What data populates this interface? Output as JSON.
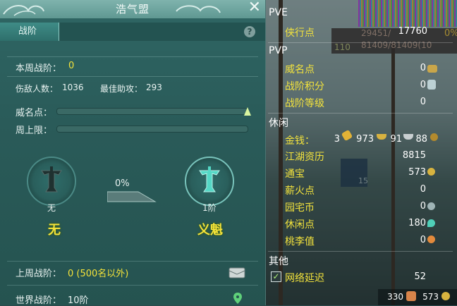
{
  "window": {
    "title": "浩气盟",
    "tab": "战阶"
  },
  "left": {
    "week_rank_label": "本周战阶：",
    "week_rank_value": "0",
    "kills_label": "伤敌人数：",
    "kills_value": "1036",
    "assist_label": "最佳助攻：",
    "assist_value": "293",
    "prestige_label": "威名点：",
    "weekly_cap_label": "周上限：",
    "current_rank_name": "无",
    "current_rank_title": "无",
    "progress_percent": "0%",
    "next_rank_name": "1阶",
    "next_rank_title": "义魁",
    "last_week_label": "上周战阶：",
    "last_week_value": "0 (500名以外)",
    "world_rank_label": "世界战阶：",
    "world_rank_value": "10阶"
  },
  "right": {
    "pve": {
      "header": "PVE",
      "items": [
        {
          "label": "侠行点",
          "value": "17760"
        }
      ]
    },
    "pvp": {
      "header": "PVP",
      "items": [
        {
          "label": "威名点",
          "value": "0"
        },
        {
          "label": "战阶积分",
          "value": "0"
        },
        {
          "label": "战阶等级",
          "value": "0"
        }
      ]
    },
    "leisure": {
      "header": "休闲",
      "money_label": "金钱：",
      "money_brick": "3",
      "money_gold": "973",
      "money_silver": "91",
      "money_copper": "88",
      "items": [
        {
          "label": "江湖资历",
          "value": "8815"
        },
        {
          "label": "通宝",
          "value": "573"
        },
        {
          "label": "薪火点",
          "value": "0"
        },
        {
          "label": "园宅币",
          "value": "0"
        },
        {
          "label": "休闲点",
          "value": "180"
        },
        {
          "label": "桃李值",
          "value": "0"
        }
      ]
    },
    "other": {
      "header": "其他",
      "latency_label": "网络延迟",
      "latency_value": "52"
    },
    "footer": {
      "left_value": "330",
      "right_value": "573"
    }
  },
  "background": {
    "stats1": "29451/",
    "stats2": "81409/81409(10",
    "level": "110",
    "pct": "0%",
    "bag_slot": "15"
  }
}
